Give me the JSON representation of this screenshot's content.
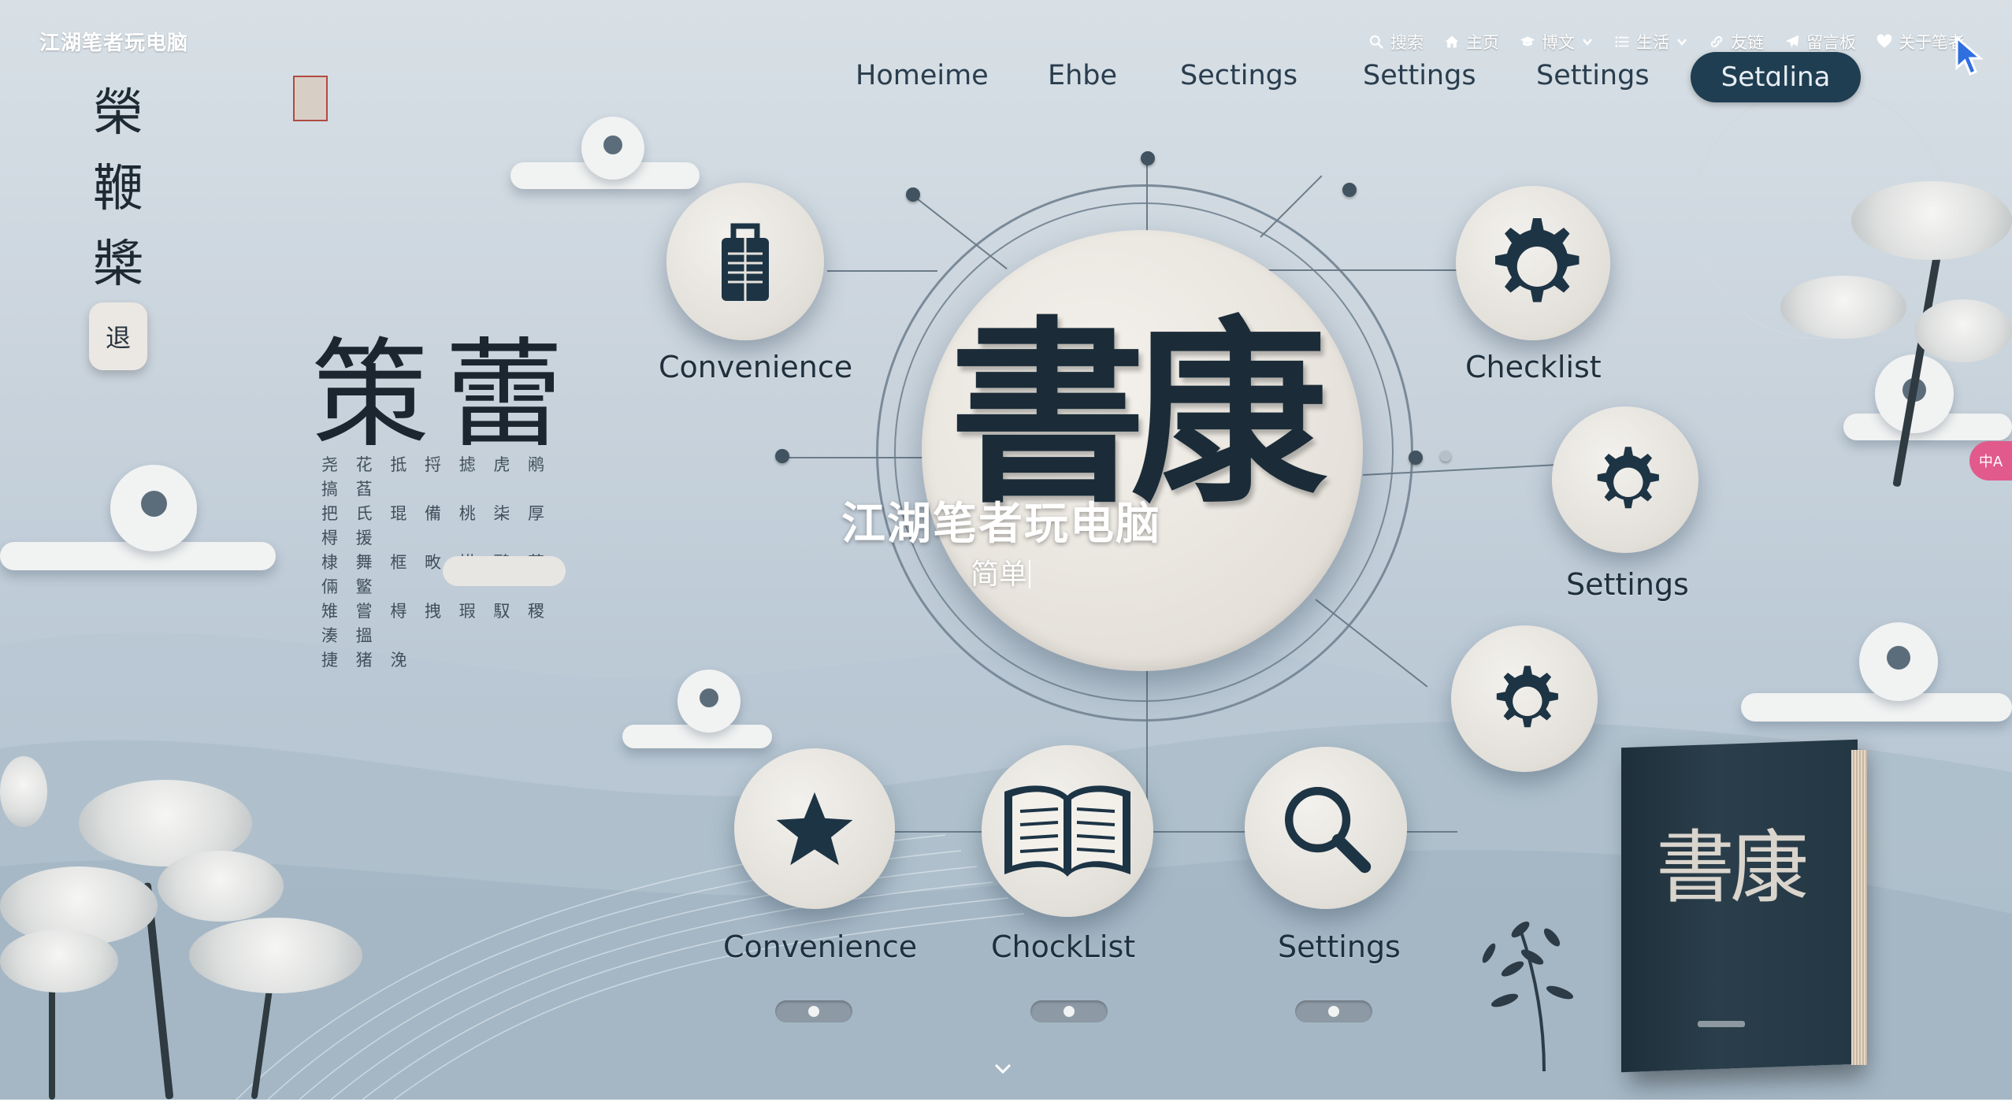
{
  "site": {
    "title": "江湖笔者玩电脑"
  },
  "topnav": {
    "items": [
      {
        "label": "搜索",
        "icon": "search-icon"
      },
      {
        "label": "主页",
        "icon": "home-icon"
      },
      {
        "label": "博文",
        "icon": "graduation-cap-icon",
        "dropdown": true
      },
      {
        "label": "生活",
        "icon": "list-icon",
        "dropdown": true
      },
      {
        "label": "友链",
        "icon": "link-icon"
      },
      {
        "label": "留言板",
        "icon": "paper-plane-icon"
      },
      {
        "label": "关于笔者",
        "icon": "heart-icon"
      }
    ]
  },
  "hero": {
    "title": "江湖笔者玩电脑",
    "subtitle": "简单"
  },
  "illustration": {
    "nav_labels": [
      "Homeime",
      "Ehbe",
      "Sectings",
      "Settings",
      "Settings"
    ],
    "nav_pill": "Setɑlina",
    "hub_glyphs": "書康",
    "left_big_glyphs": "策蕾",
    "left_vertical_glyphs": [
      "榮",
      "鞭",
      "槳"
    ],
    "seal_glyph": "退",
    "book_title": "書康",
    "small_grid_text": "尧 花 抵 捋 摅 虎 鹇 搞 萏\n把 氏 琨 備 桃 柒 厚 棏 援\n棣 舞 框 畋 描 鹝 茄 倆 鳘\n雉 嘗 棏 拽 瑕 馭 稷 湊 搵\n捷 猪 浼",
    "nodes": [
      {
        "label": "Convenience",
        "icon": "briefcase-icon"
      },
      {
        "label": "Checklist",
        "icon": "gear-icon"
      },
      {
        "label": "Settings",
        "icon": "gear-icon"
      },
      {
        "label": "",
        "icon": "gear-icon"
      },
      {
        "label": "Convenience",
        "icon": "star-icon"
      },
      {
        "label": "ChockList",
        "icon": "book-icon"
      },
      {
        "label": "Settings",
        "icon": "magnifier-icon"
      }
    ]
  },
  "colors": {
    "accent": "#1f3e52",
    "ink": "#1b2c38",
    "badge": "#e25a8b"
  },
  "lang_badge": "中A"
}
